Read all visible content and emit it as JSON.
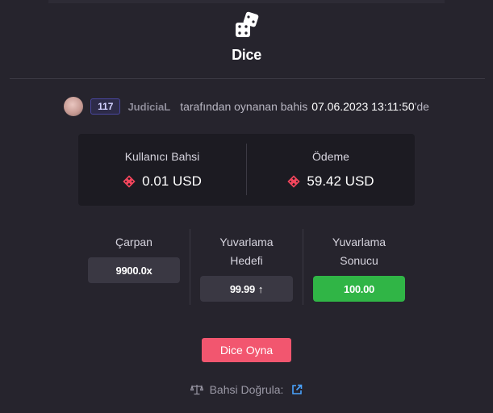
{
  "modal": {
    "title": "Dice"
  },
  "byline": {
    "level": "117",
    "username": "JudiciaL",
    "text": "tarafından oynanan bahis",
    "datetime": "07.06.2023 13:11:50",
    "suffix": "'de"
  },
  "amounts": {
    "bet_label": "Kullanıcı Bahsi",
    "bet_value": "0.01 USD",
    "payout_label": "Ödeme",
    "payout_value": "59.42 USD",
    "currency_icon": "bnb-coin-icon"
  },
  "stats": {
    "multiplier_label": "Çarpan",
    "multiplier_value": "9900.0x",
    "target_label": "Yuvarlama Hedefi",
    "target_value": "99.99",
    "target_direction": "↑",
    "result_label": "Yuvarlama Sonucu",
    "result_value": "100.00"
  },
  "play_button": "Dice Oyna",
  "verify": {
    "label": "Bahsi Doğrula:"
  },
  "colors": {
    "background": "#26242d",
    "panel": "#1c1b22",
    "accent": "#f2566f",
    "success": "#30b546",
    "coin": "#f6465d"
  }
}
